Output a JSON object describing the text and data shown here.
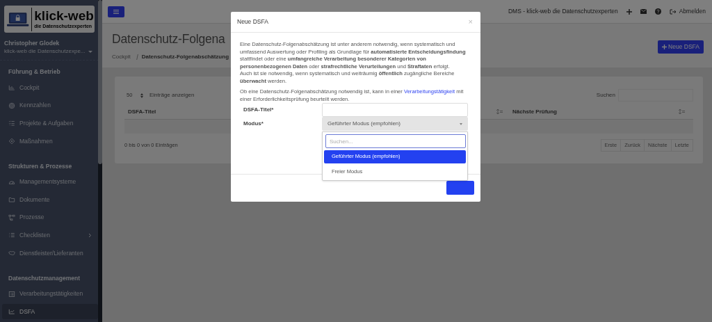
{
  "sidebar": {
    "logo": {
      "title": "klick-web",
      "subtitle": "die Datenschutzexperten"
    },
    "user": {
      "name": "Christopher Glodek",
      "organization": "klick-web die Datenschutzexpe..."
    },
    "sections": [
      {
        "heading": "Führung & Betrieb",
        "items": [
          {
            "label": "Cockpit",
            "selected": false,
            "expandable": false
          },
          {
            "label": "Kennzahlen",
            "selected": false,
            "expandable": false
          },
          {
            "label": "Projekte & Aufgaben",
            "selected": false,
            "expandable": false
          },
          {
            "label": "Maßnahmen",
            "selected": false,
            "expandable": false
          }
        ]
      },
      {
        "heading": "Strukturen & Prozesse",
        "items": [
          {
            "label": "Managementsysteme",
            "selected": false,
            "expandable": false
          },
          {
            "label": "Dokumente",
            "selected": false,
            "expandable": false
          },
          {
            "label": "Prozesse",
            "selected": false,
            "expandable": false
          },
          {
            "label": "Checklisten",
            "selected": false,
            "expandable": true
          },
          {
            "label": "Dienstleister/Lieferanten",
            "selected": false,
            "expandable": false
          }
        ]
      },
      {
        "heading": "Datenschutzmanagement",
        "items": [
          {
            "label": "Verarbeitungstätigkeiten",
            "selected": false,
            "expandable": false
          },
          {
            "label": "DSFA",
            "selected": true,
            "expandable": false
          }
        ]
      }
    ]
  },
  "topbar": {
    "site": "DMS - klick-web die Datenschutzexperten",
    "logout": "Abmelden"
  },
  "page": {
    "title": "Datenschutz-Folgena",
    "breadcrumb": [
      "Cockpit",
      "Datenschutz-Folgenabschätzung"
    ],
    "new_button": "Neue DSFA"
  },
  "table": {
    "page_length": "50",
    "length_label": "Einträge anzeigen",
    "search_label": "Suchen",
    "columns": [
      "DSFA-Titel",
      "Nächste Prüfung"
    ],
    "info": "0 bis 0 von 0 Einträgen",
    "pagination": [
      "Erste",
      "Zurück",
      "Nächste",
      "Letzte"
    ]
  },
  "modal": {
    "title": "Neue DSFA",
    "close": "×",
    "paragraphs": [
      "Eine Datenschutz-Folgenabschätzung ist unter anderem notwendig, wenn systematisch und umfassend Auswertung oder Profiling als Grundlage für **automatisierte Entscheidungsfindung** stattfindet oder eine **umfangreiche Verarbeitung besonderer Kategorien von personenbezogenen Daten** oder **strafrechtliche Verurteilungen** und **Straftaten** erfolgt.",
      "Auch ist sie notwendig, wenn systematisch und weiträumig **öffentlich** zugängliche Bereiche **überwacht** werden."
    ],
    "note": {
      "before": "Ob eine Datenschutz-Folgenabschätzung notwendig ist, kann in einer ",
      "link": "Verarbeitungstätigkeit",
      "after": " mit einer Erforderlichkeitsprüfung beurteilt werden."
    },
    "fields": [
      {
        "kind": "text",
        "label": "DSFA-Titel*"
      },
      {
        "kind": "select",
        "label": "Modus*",
        "value": "Geführter Modus (empfohlen)",
        "expanded": true,
        "search_placeholder": "Suchen...",
        "options": [
          {
            "label": "Geführter Modus (empfohlen)",
            "selected": true
          },
          {
            "label": "Freier Modus",
            "selected": false
          }
        ]
      }
    ]
  }
}
